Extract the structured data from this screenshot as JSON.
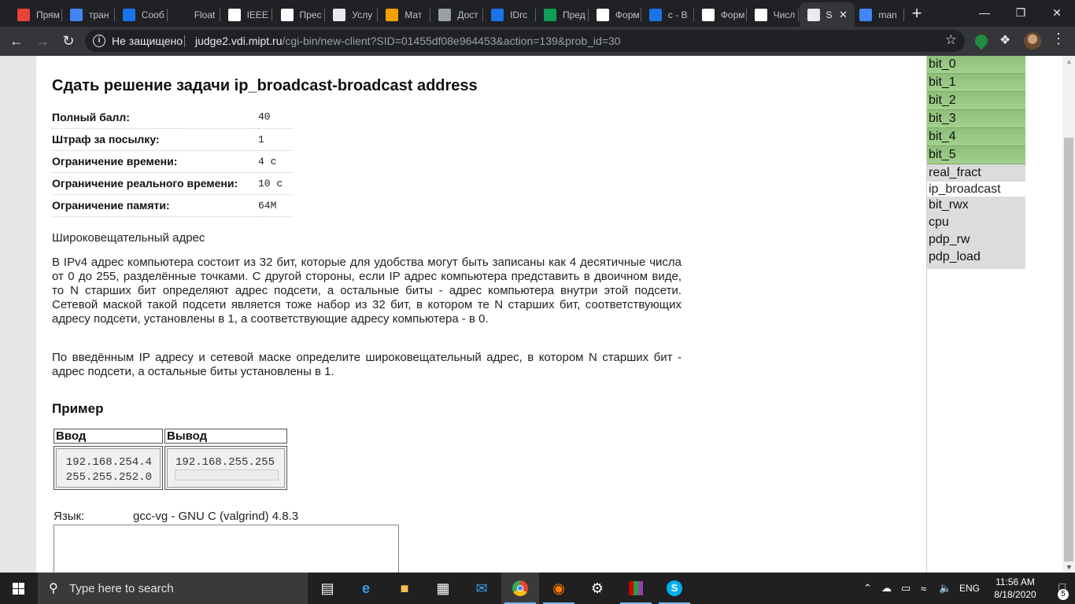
{
  "browser": {
    "tabs": [
      {
        "label": "Прям",
        "icon": "page-icon",
        "color": "#ea4335"
      },
      {
        "label": "тран",
        "icon": "google-icon",
        "color": "#4285f4"
      },
      {
        "label": "Сооб",
        "icon": "chat-icon",
        "color": "#1a73e8"
      },
      {
        "label": "Float",
        "icon": "blank-icon",
        "color": "#202124"
      },
      {
        "label": "IEEE",
        "icon": "wikipedia-icon",
        "color": "#ffffff"
      },
      {
        "label": "Прес",
        "icon": "doc-icon",
        "color": "#ffffff"
      },
      {
        "label": "Услу",
        "icon": "globe-icon",
        "color": "#e8eaed"
      },
      {
        "label": "Мат",
        "icon": "m-icon",
        "color": "#f4a100"
      },
      {
        "label": "Дост",
        "icon": "globe-icon",
        "color": "#9aa0a6"
      },
      {
        "label": "IDrc",
        "icon": "grid-icon",
        "color": "#1a73e8"
      },
      {
        "label": "Пред",
        "icon": "bookmark-icon",
        "color": "#0f9d58"
      },
      {
        "label": "Форм",
        "icon": "doc-icon",
        "color": "#ffffff"
      },
      {
        "label": "c - В",
        "icon": "stack-icon",
        "color": "#1a73e8"
      },
      {
        "label": "Форм",
        "icon": "doc-icon",
        "color": "#ffffff"
      },
      {
        "label": "Числ",
        "icon": "wikipedia-icon",
        "color": "#ffffff"
      },
      {
        "label": "S",
        "icon": "globe-icon",
        "color": "#e8eaed",
        "active": true
      },
      {
        "label": "man",
        "icon": "google-icon",
        "color": "#4285f4"
      }
    ],
    "omnibox": {
      "security": "Не защищено",
      "host": "judge2.vdi.mipt.ru",
      "path": "/cgi-bin/new-client?SID=01455df08e964453&action=139&prob_id=30"
    }
  },
  "page": {
    "title": "Сдать решение задачи ip_broadcast-broadcast address",
    "params": [
      {
        "key": "Полный балл:",
        "value": "40"
      },
      {
        "key": "Штраф за посылку:",
        "value": "1"
      },
      {
        "key": "Ограничение времени:",
        "value": "4 с"
      },
      {
        "key": "Ограничение реального времени:",
        "value": "10 с"
      },
      {
        "key": "Ограничение памяти:",
        "value": "64M"
      }
    ],
    "statement_title": "Широковещательный адрес",
    "paragraph1": "В IPv4 адрес компьютера состоит из 32 бит, которые для удобства могут быть записаны как 4 десятичные числа от 0 до 255, разделённые точками. С другой стороны, если IP адрес компьютера представить в двоичном виде, то N старших бит определяют адрес подсети, а остальные биты - адрес компьютера внутри этой подсети. Сетевой маской такой подсети является тоже набор из 32 бит, в котором те N старших бит, соответствующих адресу подсети, установлены в 1, а соответствующие адресу компьютера - в 0.",
    "paragraph2": "По введённым IP адресу и сетевой маске определите широковещательный адрес, в котором N старших бит - адрес подсети, а остальные биты установлены в 1.",
    "example": {
      "heading": "Пример",
      "input_header": "Ввод",
      "output_header": "Вывод",
      "input_text": "192.168.254.4\n255.255.252.0",
      "output_text": "192.168.255.255"
    },
    "language_label": "Язык:",
    "language_value": "gcc-vg - GNU C (valgrind) 4.8.3"
  },
  "sidebar": {
    "problems": [
      {
        "label": "bit_0",
        "status": "ok"
      },
      {
        "label": "bit_1",
        "status": "ok"
      },
      {
        "label": "bit_2",
        "status": "ok"
      },
      {
        "label": "bit_3",
        "status": "ok"
      },
      {
        "label": "bit_4",
        "status": "ok"
      },
      {
        "label": "bit_5",
        "status": "ok"
      },
      {
        "label": "real_fract",
        "status": "plain"
      },
      {
        "label": "ip_broadcast",
        "status": "current"
      },
      {
        "label": "bit_rwx",
        "status": "plain"
      },
      {
        "label": "cpu",
        "status": "plain"
      },
      {
        "label": "pdp_rw",
        "status": "plain"
      },
      {
        "label": "pdp_load",
        "status": "plain"
      }
    ]
  },
  "taskbar": {
    "search_placeholder": "Type here to search",
    "language": "ENG",
    "time": "11:56 AM",
    "date": "8/18/2020",
    "notifications": "5"
  }
}
